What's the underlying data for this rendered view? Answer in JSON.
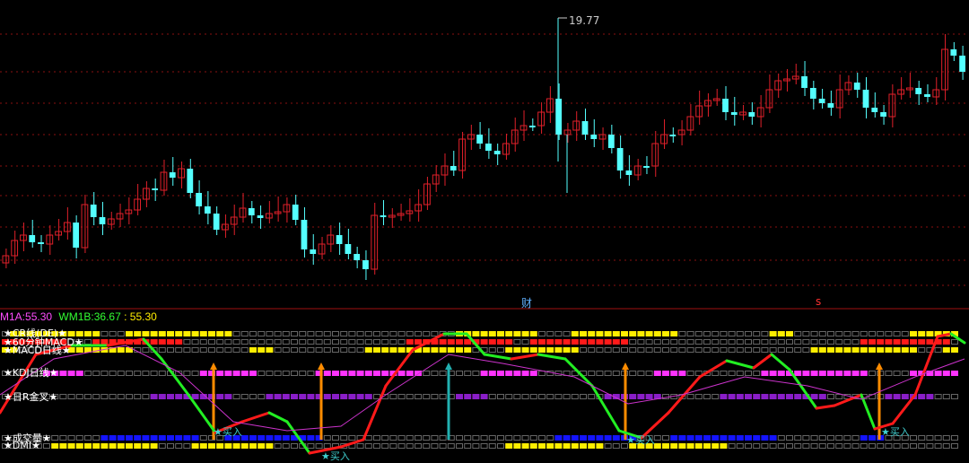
{
  "price_panel": {
    "peak_label": "19.77",
    "marker_cai": "财",
    "marker_s": "s"
  },
  "indicator_readout": {
    "wm1a_label": "M1A:",
    "wm1a_value": "55.30",
    "wm1b_label": "WM1B:",
    "wm1b_value": "36.67",
    "extra_value": ": 55.30"
  },
  "rows": {
    "row1": "★CR线(DE)★",
    "row2": "★60分钟MACD★",
    "row3": "★MACD日线★",
    "row4": "★KDJ日线★",
    "row5": "★日R金叉★",
    "row6": "★成交量★",
    "row7": "★DMI★"
  },
  "signals": {
    "buy": "买入"
  },
  "colors": {
    "up": "#e0202a",
    "down": "#54ffff",
    "grid": "#8a1010",
    "green": "#22ee22",
    "red": "#ff1a1a",
    "yellow": "#ffee00",
    "magenta": "#ff33ff",
    "purple": "#8a1ec8",
    "blue": "#1414ff",
    "orange": "#ff8c00",
    "teal": "#22b0b0"
  }
}
